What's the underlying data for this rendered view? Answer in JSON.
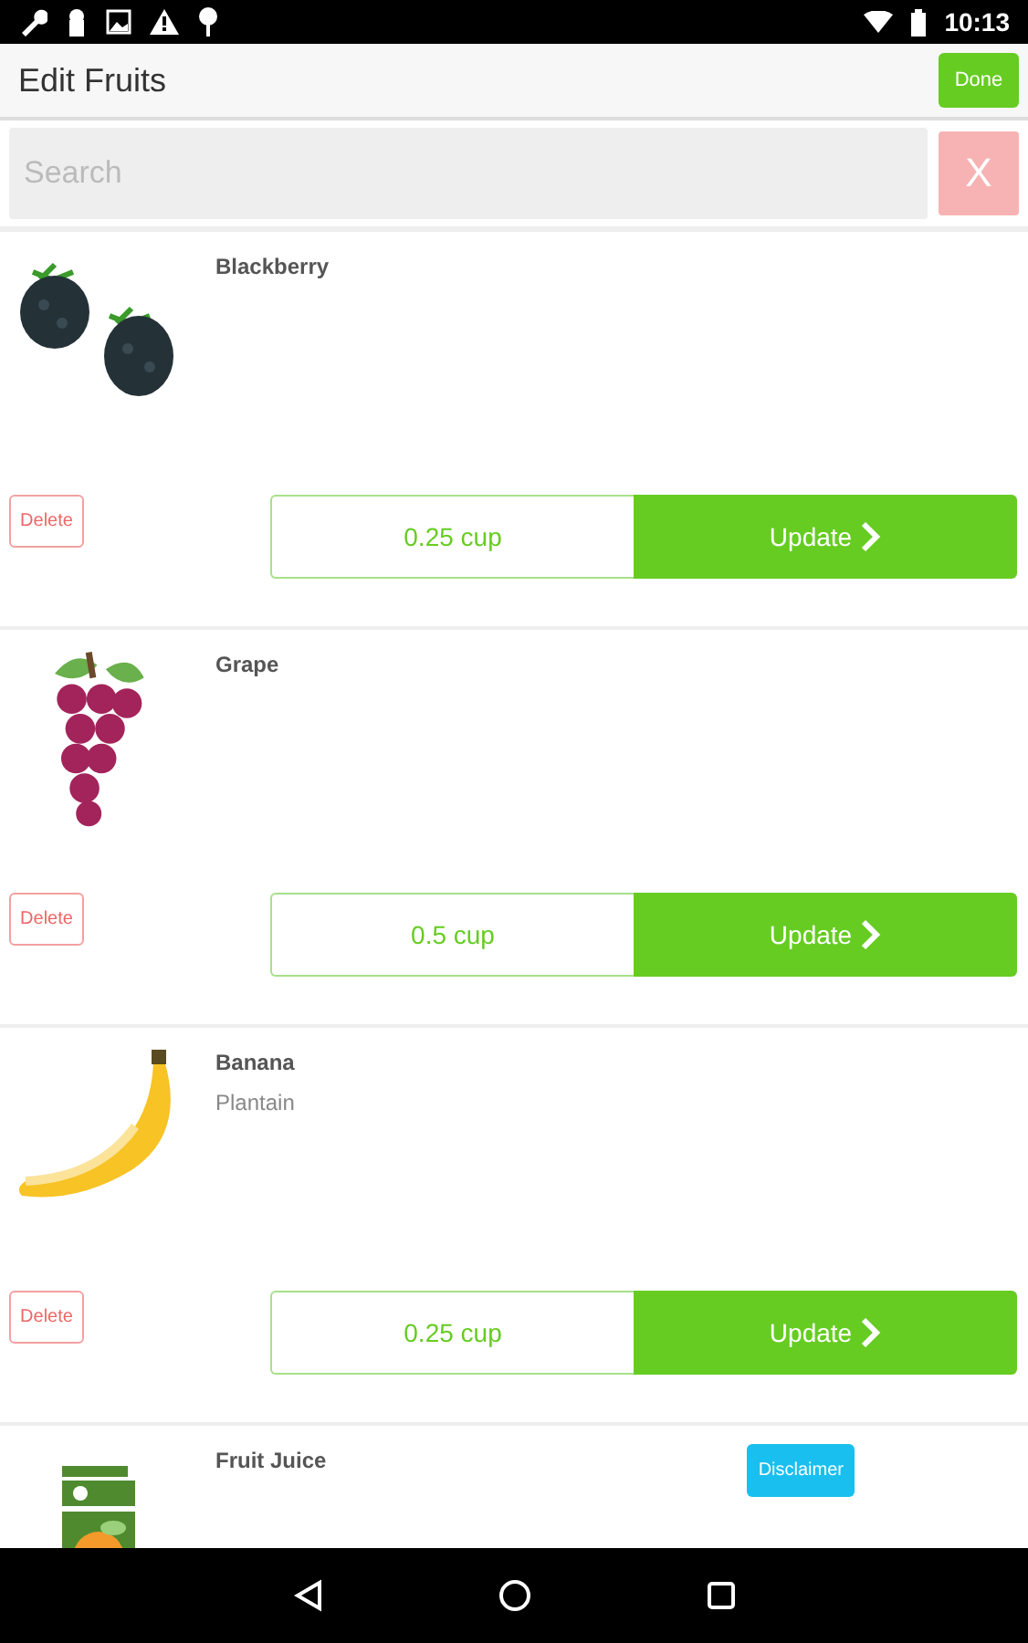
{
  "status_bar": {
    "time": "10:13"
  },
  "app_bar": {
    "title": "Edit Fruits",
    "done_button": "Done"
  },
  "search": {
    "placeholder": "Search",
    "clear_button": "X"
  },
  "items": [
    {
      "kind": "blackberry",
      "name": "Blackberry",
      "delete_button": "Delete",
      "amount": "0.25 cup",
      "update_button": "Update"
    },
    {
      "kind": "grape",
      "name": "Grape",
      "delete_button": "Delete",
      "amount": "0.5 cup",
      "update_button": "Update"
    },
    {
      "kind": "banana",
      "name": "Banana",
      "subtitle": "Plantain",
      "delete_button": "Delete",
      "amount": "0.25 cup",
      "update_button": "Update"
    },
    {
      "kind": "juice",
      "name": "Fruit Juice",
      "disclaimer_button": "Disclaimer"
    }
  ]
}
